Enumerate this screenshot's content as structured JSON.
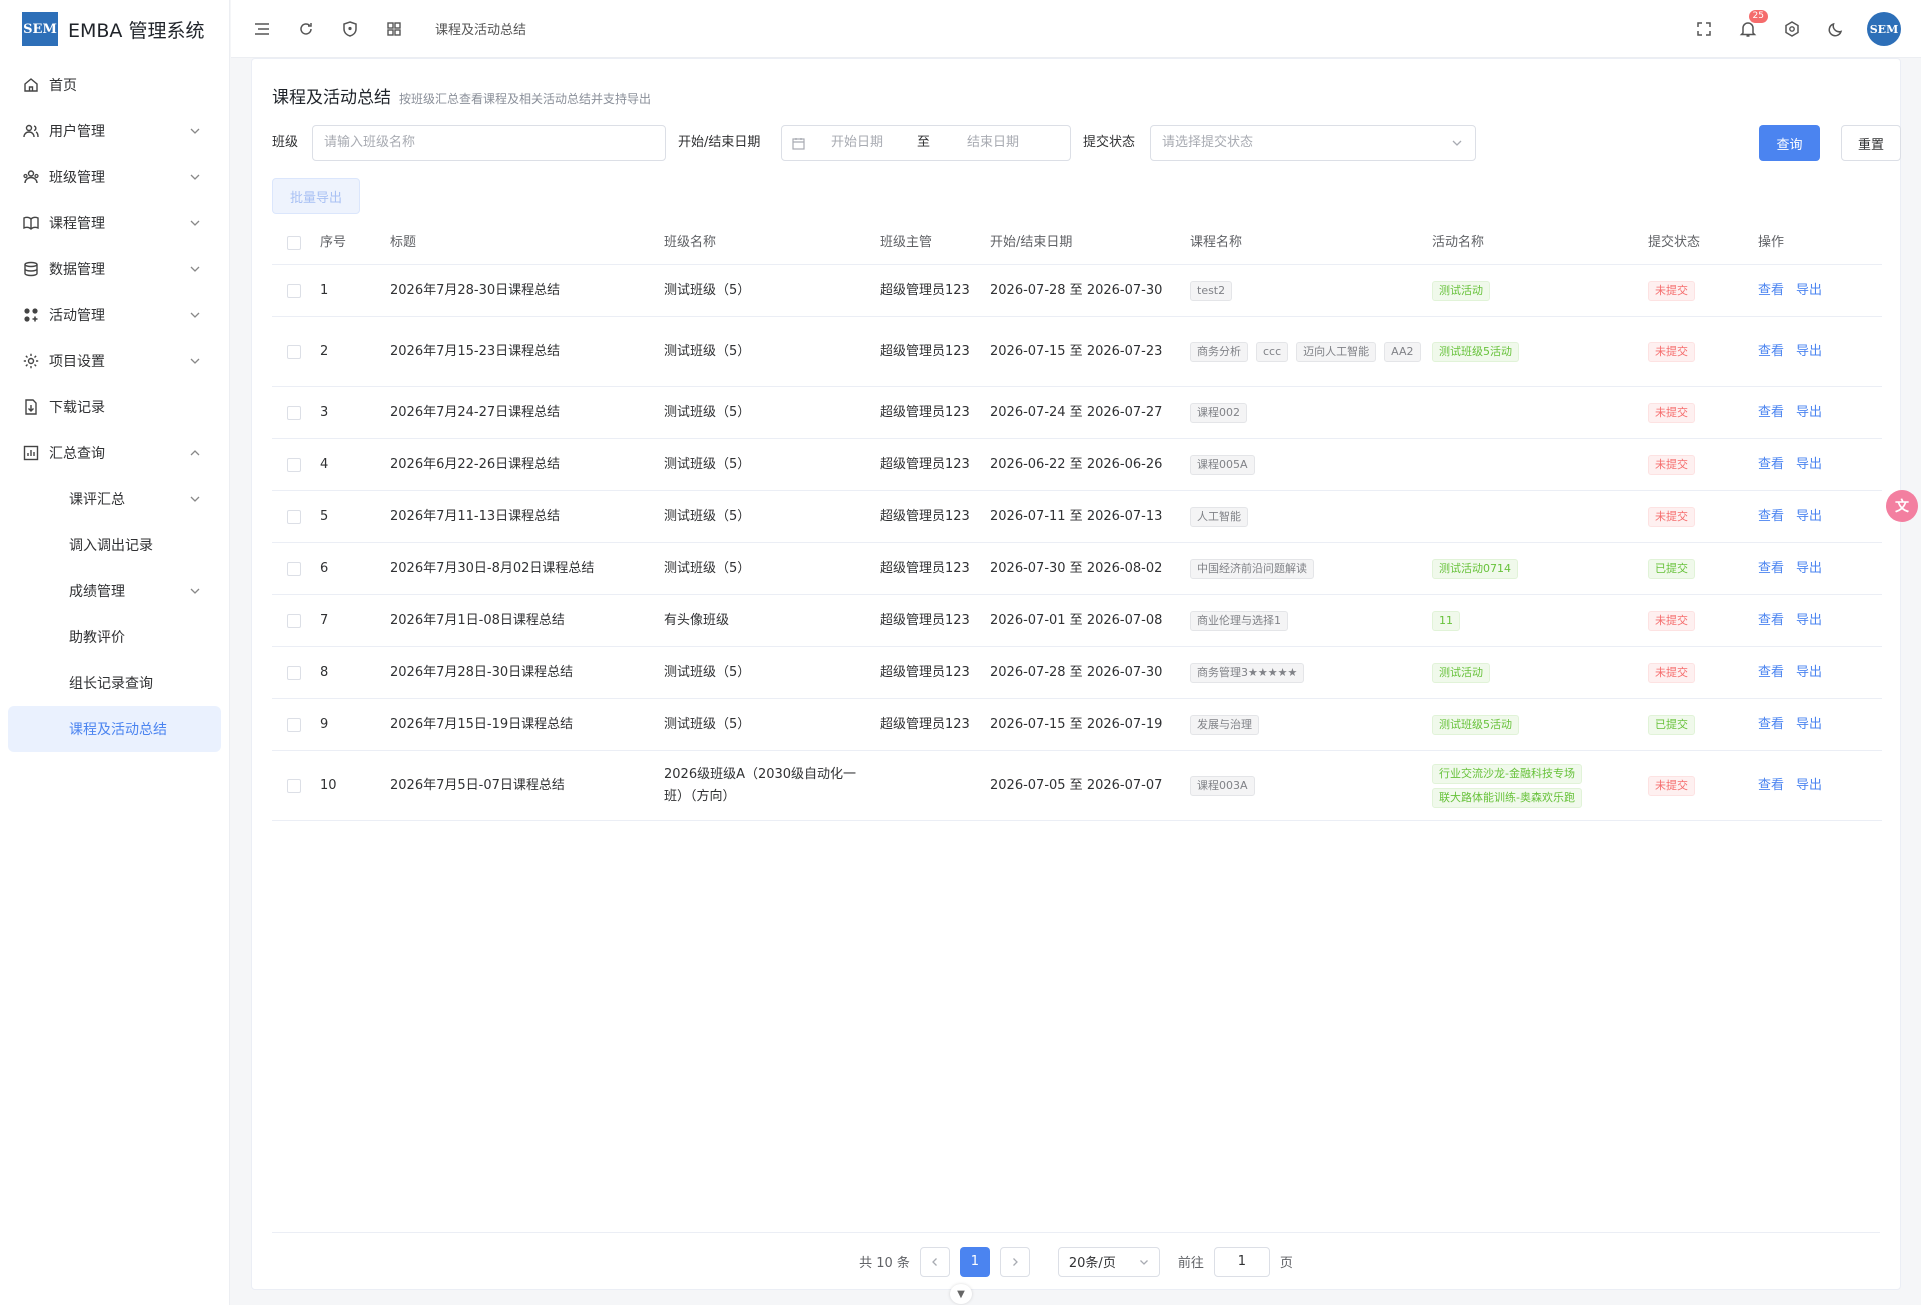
{
  "app": {
    "title": "EMBA 管理系统",
    "logo_text": "SEM"
  },
  "sidebar": {
    "items": [
      {
        "label": "首页",
        "icon": "home-icon",
        "expandable": false
      },
      {
        "label": "用户管理",
        "icon": "users-icon",
        "expandable": true
      },
      {
        "label": "班级管理",
        "icon": "class-icon",
        "expandable": true
      },
      {
        "label": "课程管理",
        "icon": "book-icon",
        "expandable": true
      },
      {
        "label": "数据管理",
        "icon": "database-icon",
        "expandable": true
      },
      {
        "label": "活动管理",
        "icon": "activity-icon",
        "expandable": true
      },
      {
        "label": "项目设置",
        "icon": "settings-icon",
        "expandable": true
      },
      {
        "label": "下载记录",
        "icon": "download-icon",
        "expandable": false
      },
      {
        "label": "汇总查询",
        "icon": "chart-icon",
        "expandable": true,
        "expanded": true
      }
    ],
    "sub_items": [
      {
        "label": "课评汇总",
        "expandable": true
      },
      {
        "label": "调入调出记录",
        "expandable": false
      },
      {
        "label": "成绩管理",
        "expandable": true
      },
      {
        "label": "助教评价",
        "expandable": false
      },
      {
        "label": "组长记录查询",
        "expandable": false
      },
      {
        "label": "课程及活动总结",
        "expandable": false,
        "active": true
      }
    ]
  },
  "topbar": {
    "breadcrumb": "课程及活动总结",
    "notification_count": "25",
    "avatar_text": "SEM"
  },
  "page": {
    "title": "课程及活动总结",
    "subtitle": "按班级汇总查看课程及相关活动总结并支持导出"
  },
  "filters": {
    "class_label": "班级",
    "class_placeholder": "请输入班级名称",
    "date_label": "开始/结束日期",
    "start_placeholder": "开始日期",
    "date_sep": "至",
    "end_placeholder": "结束日期",
    "status_label": "提交状态",
    "status_placeholder": "请选择提交状态",
    "search_btn": "查询",
    "reset_btn": "重置",
    "batch_export_btn": "批量导出"
  },
  "table": {
    "headers": [
      "序号",
      "标题",
      "班级名称",
      "班级主管",
      "开始/结束日期",
      "课程名称",
      "活动名称",
      "提交状态",
      "操作"
    ],
    "view_label": "查看",
    "export_label": "导出",
    "rows": [
      {
        "no": "1",
        "title": "2026年7月28-30日课程总结",
        "class": "测试班级（5）",
        "manager": "超级管理员123",
        "date": "2026-07-28 至 2026-07-30",
        "courses": [
          "test2"
        ],
        "activities": [
          "测试活动"
        ],
        "status": "未提交"
      },
      {
        "no": "2",
        "title": "2026年7月15-23日课程总结",
        "class": "测试班级（5）",
        "manager": "超级管理员123",
        "date": "2026-07-15 至 2026-07-23",
        "courses": [
          "商务分析",
          "ccc",
          "迈向人工智能",
          "AA2"
        ],
        "activities": [
          "测试班级5活动"
        ],
        "status": "未提交"
      },
      {
        "no": "3",
        "title": "2026年7月24-27日课程总结",
        "class": "测试班级（5）",
        "manager": "超级管理员123",
        "date": "2026-07-24 至 2026-07-27",
        "courses": [
          "课程002"
        ],
        "activities": [],
        "status": "未提交"
      },
      {
        "no": "4",
        "title": "2026年6月22-26日课程总结",
        "class": "测试班级（5）",
        "manager": "超级管理员123",
        "date": "2026-06-22 至 2026-06-26",
        "courses": [
          "课程005A"
        ],
        "activities": [],
        "status": "未提交"
      },
      {
        "no": "5",
        "title": "2026年7月11-13日课程总结",
        "class": "测试班级（5）",
        "manager": "超级管理员123",
        "date": "2026-07-11 至 2026-07-13",
        "courses": [
          "人工智能"
        ],
        "activities": [],
        "status": "未提交"
      },
      {
        "no": "6",
        "title": "2026年7月30日-8月02日课程总结",
        "class": "测试班级（5）",
        "manager": "超级管理员123",
        "date": "2026-07-30 至 2026-08-02",
        "courses": [
          "中国经济前沿问题解读"
        ],
        "activities": [
          "测试活动0714"
        ],
        "status": "已提交"
      },
      {
        "no": "7",
        "title": "2026年7月1日-08日课程总结",
        "class": "有头像班级",
        "manager": "超级管理员123",
        "date": "2026-07-01 至 2026-07-08",
        "courses": [
          "商业伦理与选择1"
        ],
        "activities": [
          "11"
        ],
        "status": "未提交"
      },
      {
        "no": "8",
        "title": "2026年7月28日-30日课程总结",
        "class": "测试班级（5）",
        "manager": "超级管理员123",
        "date": "2026-07-28 至 2026-07-30",
        "courses": [
          "商务管理3★★★★★"
        ],
        "activities": [
          "测试活动"
        ],
        "status": "未提交"
      },
      {
        "no": "9",
        "title": "2026年7月15日-19日课程总结",
        "class": "测试班级（5）",
        "manager": "超级管理员123",
        "date": "2026-07-15 至 2026-07-19",
        "courses": [
          "发展与治理"
        ],
        "activities": [
          "测试班级5活动"
        ],
        "status": "已提交"
      },
      {
        "no": "10",
        "title": "2026年7月5日-07日课程总结",
        "class": "2026级班级A（2030级自动化一班）（方向）",
        "manager": "",
        "date": "2026-07-05 至 2026-07-07",
        "courses": [
          "课程003A"
        ],
        "activities": [
          "行业交流沙龙-金融科技专场",
          "联大路体能训练-奥森欢乐跑"
        ],
        "status": "未提交"
      }
    ]
  },
  "pagination": {
    "total": "共 10 条",
    "current_page": "1",
    "page_size": "20条/页",
    "goto_label": "前往",
    "goto_value": "1",
    "page_unit": "页"
  },
  "colors": {
    "primary": "#4b84f0",
    "success": "#67c23a",
    "danger": "#f56c6c"
  }
}
